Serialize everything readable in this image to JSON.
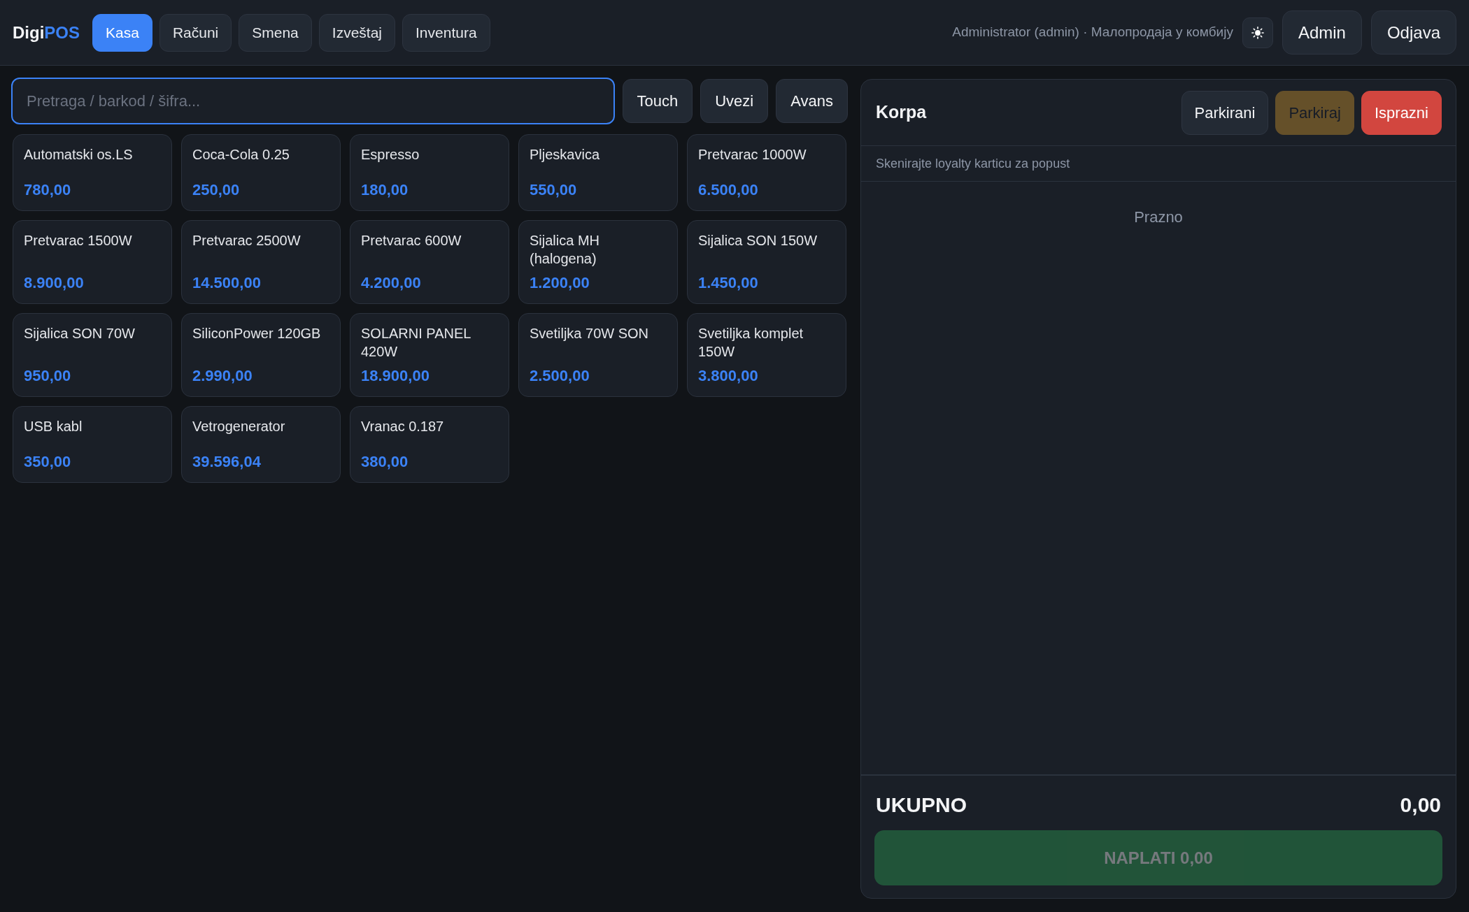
{
  "header": {
    "logo": {
      "text": "Digi",
      "accent": "POS"
    },
    "tabs": [
      {
        "label": "Kasa",
        "selected": true
      },
      {
        "label": "Računi",
        "selected": false
      },
      {
        "label": "Smena",
        "selected": false
      },
      {
        "label": "Izveštaj",
        "selected": false
      },
      {
        "label": "Inventura",
        "selected": false
      }
    ],
    "user_info": "Administrator (admin) · Малопродаја у комбију",
    "buttons": [
      "Admin",
      "Odjava"
    ]
  },
  "search": {
    "placeholder": "Pretraga / barkod / šifra..."
  },
  "toolbar_buttons": [
    "Touch",
    "Uvezi",
    "Avans"
  ],
  "products": [
    {
      "name": "Automatski os.LS",
      "price": "780,00"
    },
    {
      "name": "Coca-Cola 0.25",
      "price": "250,00"
    },
    {
      "name": "Espresso",
      "price": "180,00"
    },
    {
      "name": "Pljeskavica",
      "price": "550,00"
    },
    {
      "name": "Pretvarac 1000W",
      "price": "6.500,00"
    },
    {
      "name": "Pretvarac 1500W",
      "price": "8.900,00"
    },
    {
      "name": "Pretvarac 2500W",
      "price": "14.500,00"
    },
    {
      "name": "Pretvarac 600W",
      "price": "4.200,00"
    },
    {
      "name": "Sijalica MH (halogena)",
      "price": "1.200,00"
    },
    {
      "name": "Sijalica SON 150W",
      "price": "1.450,00"
    },
    {
      "name": "Sijalica SON 70W",
      "price": "950,00"
    },
    {
      "name": "SiliconPower 120GB",
      "price": "2.990,00"
    },
    {
      "name": "SOLARNI PANEL 420W",
      "price": "18.900,00"
    },
    {
      "name": "Svetiljka 70W SON",
      "price": "2.500,00"
    },
    {
      "name": "Svetiljka komplet 150W",
      "price": "3.800,00"
    },
    {
      "name": "USB kabl",
      "price": "350,00"
    },
    {
      "name": "Vetrogenerator",
      "price": "39.596,04"
    },
    {
      "name": "Vranac 0.187",
      "price": "380,00"
    }
  ],
  "cart": {
    "title": "Korpa",
    "buttons": [
      {
        "label": "Parkirani",
        "kind": "neutral",
        "disabled": false
      },
      {
        "label": "Parkiraj",
        "kind": "warning",
        "disabled": true
      },
      {
        "label": "Isprazni",
        "kind": "danger",
        "disabled": false
      }
    ],
    "loyalty_hint": "Skenirajte loyalty karticu za popust",
    "empty_text": "Prazno",
    "total_label": "UKUPNO",
    "total_value": "0,00",
    "pay_button": {
      "label": "NAPLATI 0,00",
      "disabled": true
    }
  }
}
